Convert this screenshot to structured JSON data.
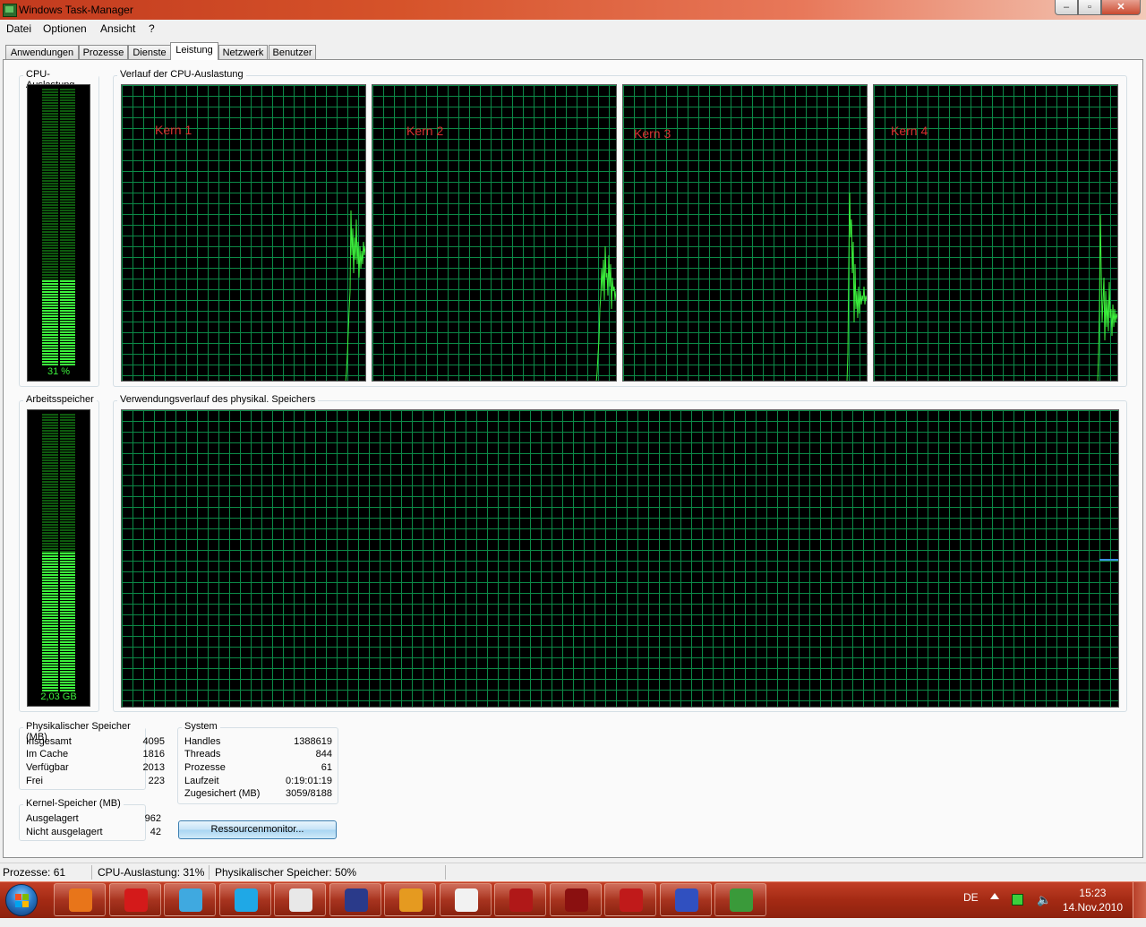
{
  "window": {
    "title": "Windows Task-Manager",
    "minimize": "–",
    "maximize": "▫",
    "close": "✕"
  },
  "menu": [
    "Datei",
    "Optionen",
    "Ansicht",
    "?"
  ],
  "tabs": [
    {
      "label": "Anwendungen",
      "active": false
    },
    {
      "label": "Prozesse",
      "active": false
    },
    {
      "label": "Dienste",
      "active": false
    },
    {
      "label": "Leistung",
      "active": true
    },
    {
      "label": "Netzwerk",
      "active": false
    },
    {
      "label": "Benutzer",
      "active": false
    }
  ],
  "cpu": {
    "usage_label": "CPU-Auslastung",
    "usage_value": "31 %",
    "usage_fraction": 0.31,
    "history_label": "Verlauf der CPU-Auslastung",
    "cores": [
      {
        "name": "Kern 1"
      },
      {
        "name": "Kern 2"
      },
      {
        "name": "Kern 3"
      },
      {
        "name": "Kern 4"
      }
    ]
  },
  "memory": {
    "label": "Arbeitsspeicher",
    "value": "2,03 GB",
    "usage_fraction": 0.5,
    "history_label": "Verwendungsverlauf des physikal. Speichers"
  },
  "physical_memory": {
    "title": "Physikalischer Speicher (MB)",
    "rows": [
      {
        "key": "Insgesamt",
        "value": "4095"
      },
      {
        "key": "Im Cache",
        "value": "1816"
      },
      {
        "key": "Verfügbar",
        "value": "2013"
      },
      {
        "key": "Frei",
        "value": "223"
      }
    ]
  },
  "kernel_memory": {
    "title": "Kernel-Speicher (MB)",
    "rows": [
      {
        "key": "Ausgelagert",
        "value": "962"
      },
      {
        "key": "Nicht ausgelagert",
        "value": "42"
      }
    ]
  },
  "system": {
    "title": "System",
    "rows": [
      {
        "key": "Handles",
        "value": "1388619"
      },
      {
        "key": "Threads",
        "value": "844"
      },
      {
        "key": "Prozesse",
        "value": "61"
      },
      {
        "key": "Laufzeit",
        "value": "0:19:01:19"
      },
      {
        "key": "Zugesichert (MB)",
        "value": "3059/8188"
      }
    ]
  },
  "resource_button": "Ressourcenmonitor...",
  "statusbar": {
    "processes": "Prozesse: 61",
    "cpu": "CPU-Auslastung: 31%",
    "memory": "Physikalischer Speicher: 50%"
  },
  "taskbar": {
    "items": [
      {
        "icon": "media-player-icon",
        "color": "#e8751a"
      },
      {
        "icon": "opera-icon",
        "color": "#d41a1a"
      },
      {
        "icon": "messenger-icon",
        "color": "#3fa9e0"
      },
      {
        "icon": "skype-icon",
        "color": "#1fa8e6"
      },
      {
        "icon": "scorpion-icon",
        "color": "#e8e8e8"
      },
      {
        "icon": "dr2-game-icon",
        "color": "#2a3a8a"
      },
      {
        "icon": "game-warrior-icon",
        "color": "#e59a20"
      },
      {
        "icon": "cat-icon",
        "color": "#f2f2f2"
      },
      {
        "icon": "shield-game-icon",
        "color": "#b01818"
      },
      {
        "icon": "crossfire-icon",
        "color": "#8a1010"
      },
      {
        "icon": "flash-icon",
        "color": "#c01a1a"
      },
      {
        "icon": "wizard-icon",
        "color": "#3050c0"
      },
      {
        "icon": "task-manager-icon",
        "color": "#3a9a3a"
      }
    ],
    "language": "DE",
    "time": "15:23",
    "date": "14.Nov.2010"
  }
}
